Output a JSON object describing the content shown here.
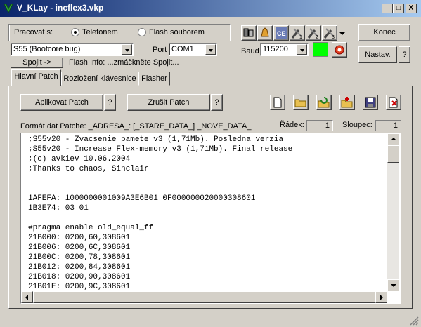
{
  "window": {
    "title": "V_KLay - incflex3.vkp",
    "minimize": "_",
    "maximize": "□",
    "close": "X"
  },
  "connection": {
    "work_with_label": "Pracovat s:",
    "radio_phone": "Telefonem",
    "radio_flash": "Flash souborem",
    "selected_mode": "Telefonem",
    "phone_model": "S55 (Bootcore bug)",
    "port_label": "Port",
    "port_value": "COM1",
    "baud_label": "Baud",
    "baud_value": "115200",
    "connect_button": "Spojit ->",
    "flash_info": "Flash Info: ...zmáčkněte Spojit...",
    "status_color": "#00ff00"
  },
  "right_buttons": {
    "end": "Konec",
    "settings": "Nastav.",
    "help": "?"
  },
  "tabs": [
    {
      "label": "Hlavní Patch",
      "active": true
    },
    {
      "label": "Rozložení klávesnice",
      "active": false
    },
    {
      "label": "Flasher",
      "active": false
    }
  ],
  "patch": {
    "apply_button": "Aplikovat Patch",
    "apply_help": "?",
    "cancel_button": "Zrušit Patch",
    "cancel_help": "?",
    "format_label": "Formát dat Patche: _ADRESA_: [_STARE_DATA_] _NOVE_DATA_",
    "row_label": "Řádek:",
    "row_value": "1",
    "col_label": "Sloupec:",
    "col_value": "1"
  },
  "editor_lines": [
    ";S55v20 - Zvacsenie pamete v3 (1,71Mb). Posledna verzia",
    ";S55v20 - Increase Flex-memory v3 (1,71Mb). Final release",
    ";(c) avkiev 10.06.2004",
    ";Thanks to chaos, Sinclair",
    "",
    "",
    "1AFEFA: 1000000001009A3E6B01 0F000000020000308601",
    "1B3E74: 03 01",
    "",
    "#pragma enable old_equal_ff",
    "21B000: 0200,60,308601",
    "21B006: 0200,6C,308601",
    "21B00C: 0200,78,308601",
    "21B012: 0200,84,308601",
    "21B018: 0200,90,308601",
    "21B01E: 0200,9C,308601"
  ],
  "toolbar_icons": [
    "phone-icon",
    "bell-icon",
    "ce-icon",
    "tools-1-icon",
    "tools-2-icon",
    "tools-3-icon"
  ],
  "file_icons": [
    "new-file-icon",
    "open-folder-icon",
    "reload-icon",
    "folder-add-icon",
    "save-icon",
    "delete-icon"
  ]
}
